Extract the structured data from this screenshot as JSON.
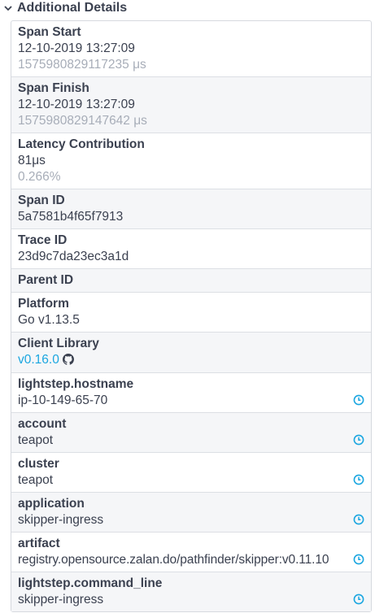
{
  "section": {
    "title": "Additional Details"
  },
  "rows": [
    {
      "label": "Span Start",
      "value": "12-10-2019 13:27:09",
      "sub": "1575980829117235 μs"
    },
    {
      "label": "Span Finish",
      "value": "12-10-2019 13:27:09",
      "sub": "1575980829147642 μs"
    },
    {
      "label": "Latency Contribution",
      "value": "81μs",
      "sub": "0.266%"
    },
    {
      "label": "Span ID",
      "value": "5a7581b4f65f7913"
    },
    {
      "label": "Trace ID",
      "value": "23d9c7da23ec3a1d"
    },
    {
      "label": "Parent ID"
    },
    {
      "label": "Platform",
      "value": "Go v1.13.5"
    },
    {
      "label": "Client Library",
      "value": "v0.16.0"
    },
    {
      "label": "lightstep.hostname",
      "value": "ip-10-149-65-70"
    },
    {
      "label": "account",
      "value": "teapot"
    },
    {
      "label": "cluster",
      "value": "teapot"
    },
    {
      "label": "application",
      "value": "skipper-ingress"
    },
    {
      "label": "artifact",
      "value": "registry.opensource.zalan.do/pathfinder/skipper:v0.11.10"
    },
    {
      "label": "lightstep.command_line",
      "value": "skipper-ingress"
    }
  ],
  "colors": {
    "link": "#1aa6e0",
    "clock": "#1aa6e0",
    "muted": "#a7adb8"
  },
  "icons": {
    "collapse": "chevron-down-icon",
    "history": "clock-icon",
    "repo": "github-icon"
  }
}
